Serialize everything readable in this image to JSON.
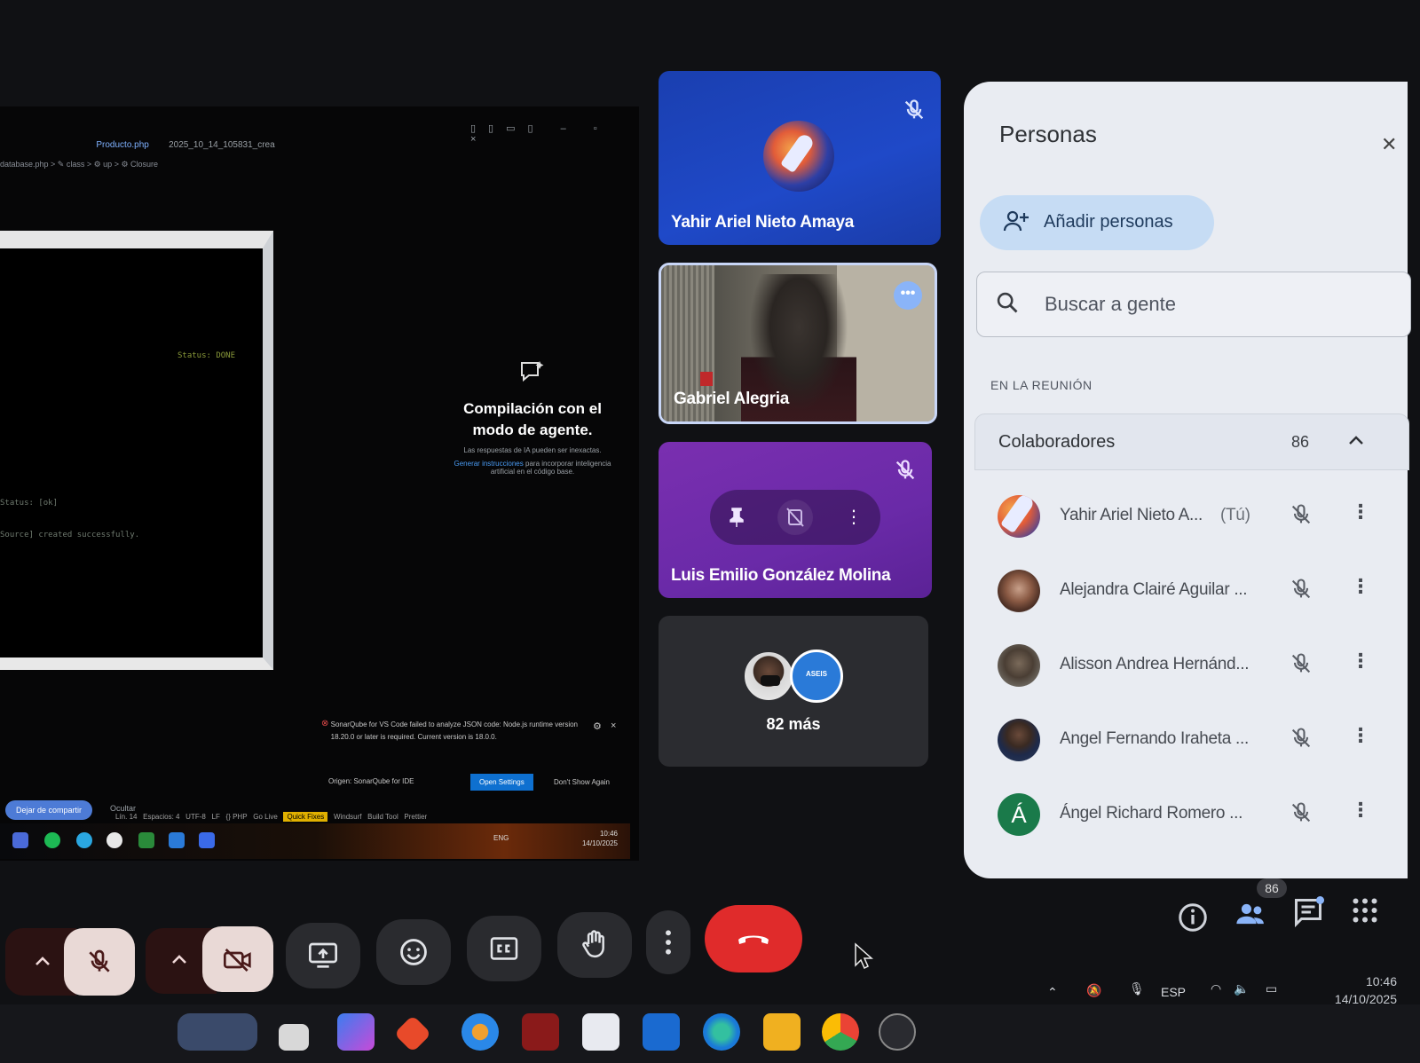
{
  "shared_screen": {
    "tabs": [
      "Producto.php",
      "2025_10_14_105831_crea"
    ],
    "breadcrumb": "database.php > ✎ class > ⚙ up > ⚙ Closure",
    "terminal_lines": [
      "Status: DONE",
      "Status: [ok]",
      "Source] created successfully."
    ],
    "agent_title": "Compilación con el modo de agente.",
    "agent_sub": "Las respuestas de IA pueden ser inexactas.",
    "agent_link": "Generar instrucciones",
    "agent_link_rest": "para incorporar inteligencia artificial en el código base.",
    "notif_text": "SonarQube for VS Code failed to analyze JSON code: Node.js runtime version 18.20.0 or later is required. Current version is 18.0.0.",
    "notif_source": "Origen: SonarQube for IDE",
    "notif_btn_open": "Open Settings",
    "notif_btn_dismiss": "Don't Show Again",
    "share_chip": "Dejar de compartir",
    "share_stop": "Ocultar",
    "status_items": [
      "Lín. 14",
      "Espacios: 4",
      "UTF-8",
      "LF",
      "{} PHP",
      "Go Live",
      "Quick Fixes",
      "Windsurf",
      "Build Tool",
      "Prettier"
    ],
    "inner_clock_time": "10:46",
    "inner_clock_date": "14/10/2025",
    "inner_lang": "ENG"
  },
  "tiles": [
    {
      "name": "Yahir Ariel Nieto Amaya",
      "muted": true,
      "color": "#1f49c8"
    },
    {
      "name": "Gabriel Alegria",
      "muted": false,
      "speaking": true
    },
    {
      "name": "Luis Emilio González Molina",
      "muted": true,
      "color": "#6a2aa8"
    },
    {
      "name": "82 más"
    }
  ],
  "panel": {
    "title": "Personas",
    "add_label": "Añadir personas",
    "search_placeholder": "Buscar a gente",
    "section": "EN LA REUNIÓN",
    "group_label": "Colaboradores",
    "group_count": "86",
    "people": [
      {
        "name": "Yahir Ariel Nieto A...",
        "you": "(Tú)",
        "avatar": "rocket-avatar",
        "muted": true
      },
      {
        "name": "Alejandra Clairé Aguilar ...",
        "avatar": "photo-avatar",
        "muted": true
      },
      {
        "name": "Alisson Andrea Hernánd...",
        "avatar": "photo-avatar",
        "muted": true
      },
      {
        "name": "Angel Fernando Iraheta ...",
        "avatar": "photo-avatar",
        "muted": true
      },
      {
        "name": "Ángel Richard Romero ...",
        "avatar": "letter-avatar",
        "initial": "Á",
        "muted": true
      }
    ]
  },
  "controls": {
    "participants_badge": "86",
    "buttons": [
      "mic-options",
      "mic-off",
      "camera-options",
      "camera-off",
      "present-screen",
      "emoji",
      "captions",
      "raise-hand",
      "more-options",
      "leave-call"
    ],
    "right_buttons": [
      "meeting-info",
      "people",
      "chat",
      "activities"
    ]
  },
  "os": {
    "lang": "ESP",
    "time": "10:46",
    "date": "14/10/2025"
  },
  "colors": {
    "end_call": "#e02b2b",
    "panel_bg": "#e9ecf2",
    "accent_blue": "#c6dcf4"
  }
}
